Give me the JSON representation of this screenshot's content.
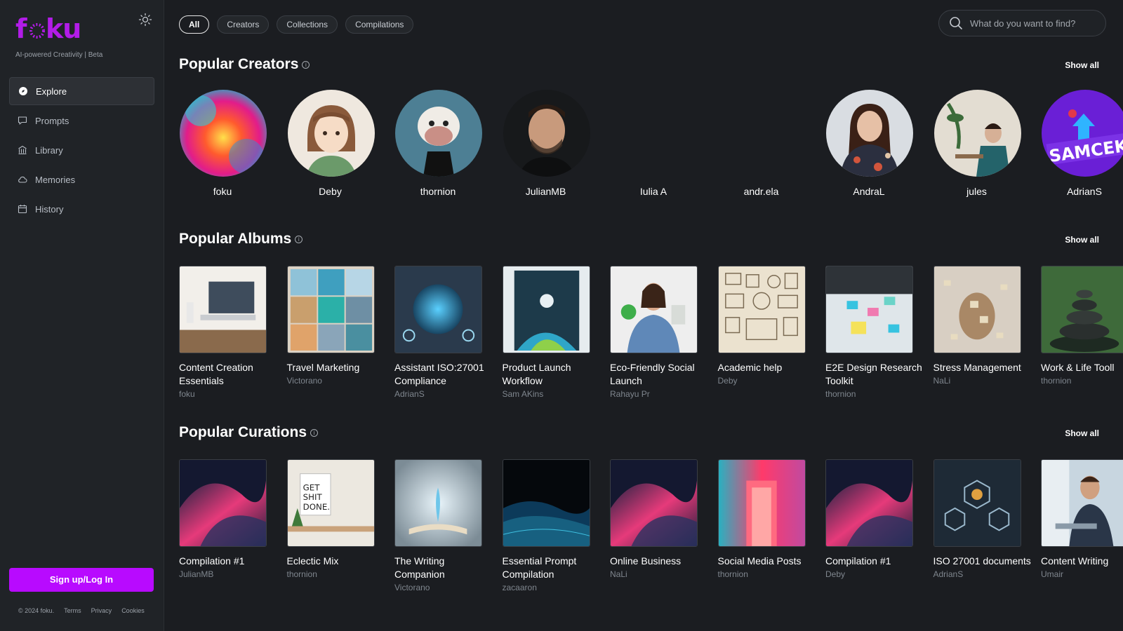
{
  "brand": {
    "logo": "foku",
    "tagline": "AI-powered Creativity | Beta"
  },
  "sidebar": {
    "items": [
      {
        "label": "Explore",
        "icon": "compass-icon",
        "active": true
      },
      {
        "label": "Prompts",
        "icon": "chat-icon"
      },
      {
        "label": "Library",
        "icon": "library-icon"
      },
      {
        "label": "Memories",
        "icon": "cloud-icon"
      },
      {
        "label": "History",
        "icon": "calendar-icon"
      }
    ],
    "signup_label": "Sign up/Log In",
    "footer": {
      "copyright": "© 2024 foku.",
      "terms": "Terms",
      "privacy": "Privacy",
      "cookies": "Cookies"
    }
  },
  "filters": [
    "All",
    "Creators",
    "Collections",
    "Compilations"
  ],
  "search": {
    "placeholder": "What do you want to find?",
    "value": ""
  },
  "sections": {
    "creators": {
      "title": "Popular Creators",
      "show_all": "Show all",
      "items": [
        "foku",
        "Deby",
        "thornion",
        "JulianMB",
        "Iulia A",
        "andr.ela",
        "AndraL",
        "jules",
        "AdrianS"
      ]
    },
    "albums": {
      "title": "Popular Albums",
      "show_all": "Show all",
      "items": [
        {
          "title": "Content Creation Essentials",
          "author": "foku"
        },
        {
          "title": "Travel Marketing",
          "author": "Victorano"
        },
        {
          "title": "Assistant ISO:27001 Compliance",
          "author": "AdrianS"
        },
        {
          "title": "Product Launch Workflow",
          "author": "Sam AKins"
        },
        {
          "title": "Eco-Friendly Social Launch",
          "author": "Rahayu Pr"
        },
        {
          "title": "Academic help",
          "author": "Deby"
        },
        {
          "title": "E2E Design Research Toolkit",
          "author": "thornion"
        },
        {
          "title": "Stress Management",
          "author": "NaLi"
        },
        {
          "title": "Work & Life Tooll",
          "author": "thornion"
        }
      ]
    },
    "curations": {
      "title": "Popular Curations",
      "show_all": "Show all",
      "items": [
        {
          "title": "Compilation #1",
          "author": "JulianMB"
        },
        {
          "title": "Eclectic Mix",
          "author": "thornion"
        },
        {
          "title": "The Writing Companion",
          "author": "Victorano"
        },
        {
          "title": "Essential Prompt Compilation",
          "author": "zacaaron"
        },
        {
          "title": "Online Business",
          "author": "NaLi"
        },
        {
          "title": "Social Media Posts",
          "author": "thornion"
        },
        {
          "title": "Compilation #1",
          "author": "Deby"
        },
        {
          "title": "ISO 27001 documents",
          "author": "AdrianS"
        },
        {
          "title": "Content Writing",
          "author": "Umair"
        }
      ]
    }
  },
  "colors": {
    "accent": "#b80aff",
    "background": "#1b1d21",
    "sidebar": "#202327"
  }
}
